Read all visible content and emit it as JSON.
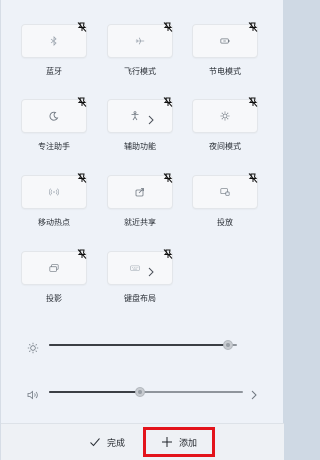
{
  "tiles": [
    {
      "label": "蓝牙",
      "icon": "bluetooth-icon"
    },
    {
      "label": "飞行模式",
      "icon": "airplane-icon"
    },
    {
      "label": "节电模式",
      "icon": "battery-saver-icon"
    },
    {
      "label": "专注助手",
      "icon": "moon-icon"
    },
    {
      "label": "辅助功能",
      "icon": "accessibility-icon"
    },
    {
      "label": "夜间模式",
      "icon": "night-light-icon"
    },
    {
      "label": "移动热点",
      "icon": "hotspot-icon"
    },
    {
      "label": "就近共享",
      "icon": "nearby-share-icon"
    },
    {
      "label": "投放",
      "icon": "cast-icon"
    },
    {
      "label": "投影",
      "icon": "project-icon"
    },
    {
      "label": "键盘布局",
      "icon": "keyboard-icon"
    }
  ],
  "brightness": {
    "icon": "brightness-icon",
    "level": 0.95
  },
  "volume": {
    "icon": "speaker-icon",
    "level": 0.47
  },
  "footer": {
    "done_label": "完成",
    "add_label": "添加"
  },
  "colors": {
    "highlight_border": "#e3131b",
    "panel_bg": "#eef2f8"
  }
}
